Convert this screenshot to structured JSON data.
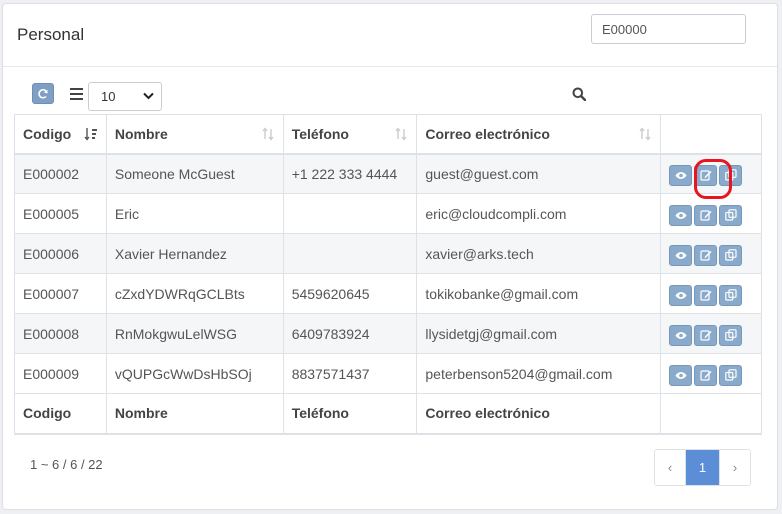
{
  "card": {
    "title": "Personal"
  },
  "toolbar": {
    "refresh_icon": "refresh-icon",
    "columns_icon": "list-icon",
    "page_size": "10",
    "search_icon": "search-icon",
    "search_value": "E00000"
  },
  "table": {
    "columns": [
      "Codigo",
      "Nombre",
      "Teléfono",
      "Correo electrónico"
    ],
    "rows": [
      {
        "code": "E000002",
        "name": "Someone McGuest",
        "phone": "+1 222 333 4444",
        "email": "guest@guest.com"
      },
      {
        "code": "E000005",
        "name": "Eric",
        "phone": "",
        "email": "eric@cloudcompli.com"
      },
      {
        "code": "E000006",
        "name": "Xavier Hernandez",
        "phone": "",
        "email": "xavier@arks.tech"
      },
      {
        "code": "E000007",
        "name": "cZxdYDWRqGCLBts",
        "phone": "5459620645",
        "email": "tokikobanke@gmail.com"
      },
      {
        "code": "E000008",
        "name": "RnMokgwuLelWSG",
        "phone": "6409783924",
        "email": "llysidetgj@gmail.com"
      },
      {
        "code": "E000009",
        "name": "vQUPGcWwDsHbSOj",
        "phone": "8837571437",
        "email": "peterbenson5204@gmail.com"
      }
    ],
    "footer": [
      "Codigo",
      "Nombre",
      "Teléfono",
      "Correo electrónico"
    ],
    "row_actions": [
      "eye-icon",
      "edit-icon",
      "copy-icon"
    ]
  },
  "pagination": {
    "info": "1 ~ 6 / 6 / 22",
    "prev": "‹",
    "current": "1",
    "next": "›"
  },
  "colors": {
    "accent": "#5b8ed6",
    "action_button": "#8aaacb",
    "highlight": "#e8141e"
  }
}
